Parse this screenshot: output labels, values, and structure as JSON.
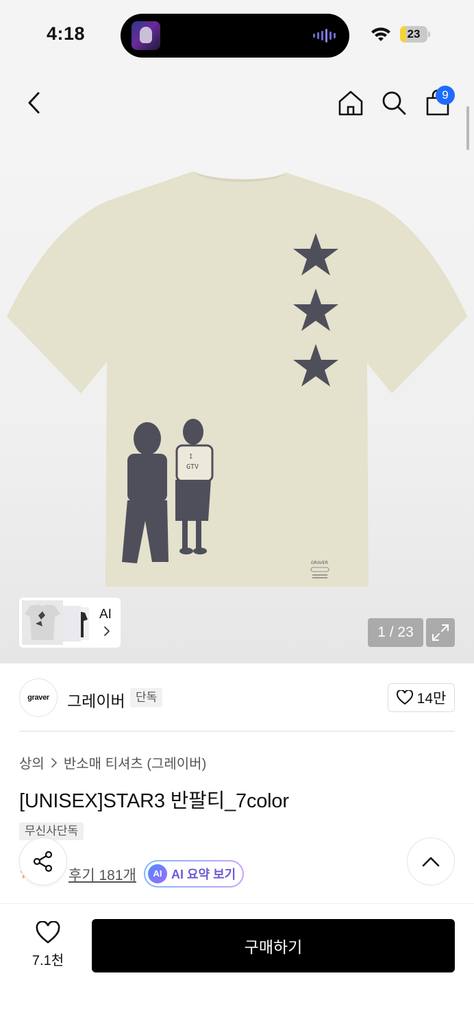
{
  "status_bar": {
    "time": "4:18",
    "battery": "23",
    "battery_level": 0.23,
    "colors": {
      "battery_fill": "#f5d33a"
    }
  },
  "nav": {
    "back_icon": "chevron-left-icon",
    "home_icon": "home-icon",
    "search_icon": "search-icon",
    "cart_icon": "shopping-bag-icon",
    "cart_badge": "9",
    "colors": {
      "badge": "#1f6bff"
    }
  },
  "gallery": {
    "counter": "1 / 23",
    "thumb_label": "AI",
    "shirt_print_text": [
      "I",
      "GTV"
    ],
    "label_text": "GRAVER"
  },
  "brand": {
    "logo_text": "graver",
    "name": "그레이버",
    "badge": "단독",
    "likes": "14만"
  },
  "product": {
    "breadcrumb": [
      "상의",
      "반소매 티셔츠 (그레이버)"
    ],
    "title": "[UNISEX]STAR3 반팔티_7color",
    "tag": "무신사단독",
    "reviews": "후기 181개",
    "ai_badge": "AI",
    "ai_summary": "AI 요약 보기"
  },
  "bottom_bar": {
    "wish_count": "7.1천",
    "buy_label": "구매하기"
  }
}
